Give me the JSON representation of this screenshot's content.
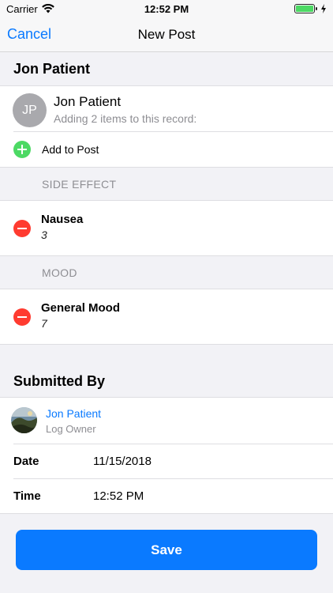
{
  "status_bar": {
    "carrier": "Carrier",
    "time": "12:52 PM",
    "battery_level": 1.0,
    "battery_color": "#4cd964"
  },
  "nav": {
    "cancel_label": "Cancel",
    "title": "New Post"
  },
  "record": {
    "section_title": "Jon Patient",
    "avatar_initials": "JP",
    "name": "Jon Patient",
    "subtitle": "Adding 2 items to this record:"
  },
  "add_to_post_label": "Add to Post",
  "groups": [
    {
      "label": "SIDE EFFECT",
      "item_name": "Nausea",
      "item_value": "3"
    },
    {
      "label": "MOOD",
      "item_name": "General Mood",
      "item_value": "7"
    }
  ],
  "submitted": {
    "section_title": "Submitted By",
    "name": "Jon Patient",
    "role": "Log Owner",
    "date_label": "Date",
    "date_value": "11/15/2018",
    "time_label": "Time",
    "time_value": "12:52 PM"
  },
  "save_label": "Save",
  "colors": {
    "accent": "#0a7aff",
    "add": "#4cd964",
    "remove": "#ff3b30"
  }
}
